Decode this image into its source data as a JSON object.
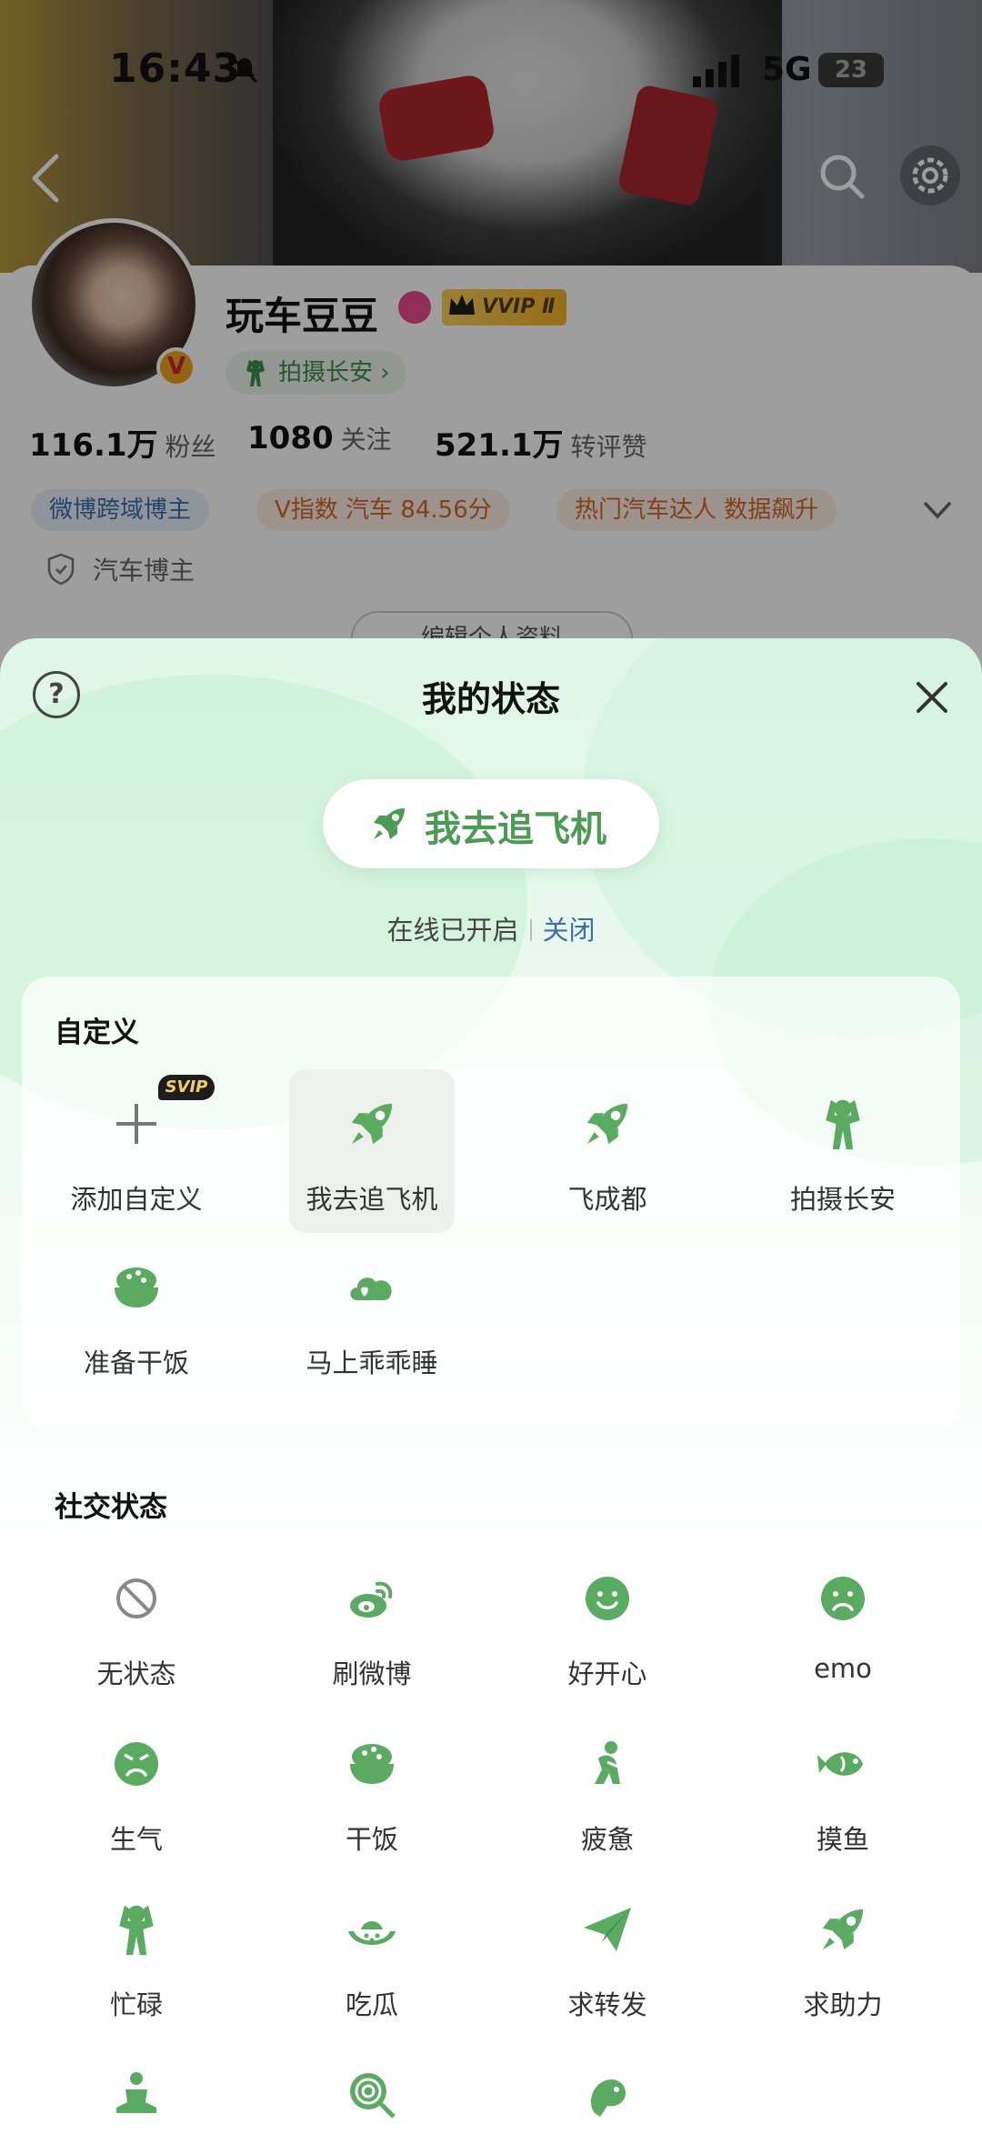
{
  "status_bar": {
    "time": "16:43",
    "network": "5G",
    "battery": "23"
  },
  "profile": {
    "name": "玩车豆豆",
    "vip_badge": "VVIP Ⅱ",
    "status_tag": "拍摄长安 ›",
    "stats": [
      {
        "value": "116.1万",
        "label": "粉丝"
      },
      {
        "value": "1080",
        "label": "关注"
      },
      {
        "value": "521.1万",
        "label": "转评赞"
      }
    ],
    "chips": [
      "微博跨域博主",
      "V指数 汽车 84.56分",
      "热门汽车达人 数据飙升"
    ],
    "blogger_type": "汽车博主",
    "edit_button": "编辑个人资料"
  },
  "sheet": {
    "title": "我的状态",
    "help": "?",
    "current_status": "我去追飞机",
    "online_text": "在线已开启",
    "off_link": "关闭",
    "custom_section": {
      "title": "自定义",
      "svip_badge": "SVIP",
      "items": [
        {
          "label": "添加自定义",
          "icon": "plus-icon"
        },
        {
          "label": "我去追飞机",
          "icon": "rocket-icon",
          "selected": true
        },
        {
          "label": "飞成都",
          "icon": "rocket-icon"
        },
        {
          "label": "拍摄长安",
          "icon": "person-hands-head-icon"
        },
        {
          "label": "准备干饭",
          "icon": "rice-bowl-icon"
        },
        {
          "label": "马上乖乖睡",
          "icon": "cloud-heart-icon"
        }
      ]
    },
    "social_section": {
      "title": "社交状态",
      "items": [
        {
          "label": "无状态",
          "icon": "no-status-icon"
        },
        {
          "label": "刷微博",
          "icon": "weibo-icon"
        },
        {
          "label": "好开心",
          "icon": "happy-face-icon"
        },
        {
          "label": "emo",
          "icon": "sad-face-icon"
        },
        {
          "label": "生气",
          "icon": "angry-face-icon"
        },
        {
          "label": "干饭",
          "icon": "rice-bowl-icon"
        },
        {
          "label": "疲惫",
          "icon": "tired-person-icon"
        },
        {
          "label": "摸鱼",
          "icon": "fish-icon"
        },
        {
          "label": "忙碌",
          "icon": "person-hands-head-icon"
        },
        {
          "label": "吃瓜",
          "icon": "watermelon-icon"
        },
        {
          "label": "求转发",
          "icon": "paper-plane-icon"
        },
        {
          "label": "求助力",
          "icon": "rocket-icon"
        },
        {
          "label": "",
          "icon": "meditate-person-icon"
        },
        {
          "label": "",
          "icon": "lollipop-icon"
        },
        {
          "label": "",
          "icon": "cloud-fish-icon"
        }
      ]
    }
  },
  "colors": {
    "accent_green": "#4c9b55",
    "link_blue": "#3d6fa7",
    "sheet_bg": "#dff6e6"
  }
}
